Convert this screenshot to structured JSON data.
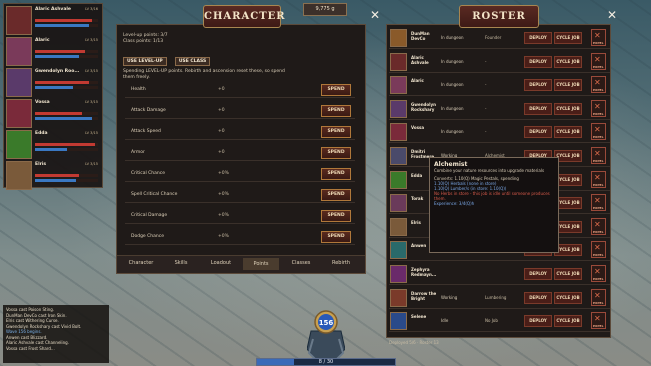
{
  "party": [
    {
      "name": "Alaric Ashvale",
      "level": "LV 3/16",
      "hp": 0.9,
      "mp": 0.85,
      "color": "#6a2a2a"
    },
    {
      "name": "Alaric",
      "level": "LV 3/15",
      "hp": 0.8,
      "mp": 0.7,
      "color": "#7a3a5a"
    },
    {
      "name": "Gwendolyn Roo...",
      "level": "LV 3/15",
      "hp": 0.85,
      "mp": 0.6,
      "color": "#5a3a6a"
    },
    {
      "name": "Vossa",
      "level": "LV 3/15",
      "hp": 0.75,
      "mp": 0.9,
      "color": "#7a2a3a"
    },
    {
      "name": "Edda",
      "level": "LV 3/15",
      "hp": 0.95,
      "mp": 0.5,
      "color": "#3a7a2a"
    },
    {
      "name": "Elris",
      "level": "LV 3/15",
      "hp": 0.7,
      "mp": 0.65,
      "color": "#7a5a3a"
    }
  ],
  "character": {
    "title": "CHARACTER",
    "level_up_points": "Level-up points: 3/7",
    "class_points": "Class points: 1/13",
    "btn_level_up": "USE LEVEL-UP",
    "btn_class": "USE CLASS",
    "desc": "Spending LEVEL-UP points. Rebirth and ascension reset these, so spend them freely.",
    "stats": [
      {
        "label": "Health",
        "value": "+0"
      },
      {
        "label": "Attack Damage",
        "value": "+0"
      },
      {
        "label": "Attack Speed",
        "value": "+0"
      },
      {
        "label": "Armor",
        "value": "+0"
      },
      {
        "label": "Critical Chance",
        "value": "+0%"
      },
      {
        "label": "Spell Critical Chance",
        "value": "+0%"
      },
      {
        "label": "Critical Damage",
        "value": "+0%"
      },
      {
        "label": "Dodge Chance",
        "value": "+0%"
      }
    ],
    "spend_label": "SPEND",
    "tabs": [
      "Character",
      "Skills",
      "Loadout",
      "Points",
      "Classes",
      "Rebirth"
    ],
    "active_tab": "Points"
  },
  "gold": "9,775 g",
  "roster": {
    "title": "ROSTER",
    "deploy_label": "DEPLOY",
    "cycle_label": "CYCLE JOB",
    "expel_label": "EXPEL",
    "rows": [
      {
        "name": "DunMan DevCo",
        "status": "In dungeon",
        "job": "Founder",
        "color": "#8a5a2a"
      },
      {
        "name": "Alaric Ashvale",
        "status": "In dungeon",
        "job": "-",
        "color": "#6a2a2a"
      },
      {
        "name": "Alaric",
        "status": "In dungeon",
        "job": "-",
        "color": "#7a3a5a"
      },
      {
        "name": "Gwendolyn Rockshary",
        "status": "In dungeon",
        "job": "-",
        "color": "#5a3a6a"
      },
      {
        "name": "Vossa",
        "status": "In dungeon",
        "job": "-",
        "color": "#7a2a3a"
      },
      {
        "name": "Dmitri Frostmere",
        "status": "Working",
        "job": "Alchemist",
        "color": "#4a4a6a"
      },
      {
        "name": "Edda",
        "status": "",
        "job": "",
        "color": "#3a7a2a"
      },
      {
        "name": "Torak",
        "status": "",
        "job": "",
        "color": "#6a3a5a"
      },
      {
        "name": "Elris",
        "status": "",
        "job": "",
        "color": "#7a5a3a"
      },
      {
        "name": "Anwen",
        "status": "",
        "job": "",
        "color": "#2a6a6a"
      },
      {
        "name": "Zephyra Redmayn...",
        "status": "",
        "job": "",
        "color": "#6a2a6a"
      },
      {
        "name": "Darrow the Bright",
        "status": "Working",
        "job": "Lumbering",
        "color": "#7a3a2a"
      },
      {
        "name": "Selene",
        "status": "Idle",
        "job": "No Job",
        "color": "#2a4a8a"
      }
    ],
    "footer": "Deployed 5/6 · Roster 13"
  },
  "tooltip": {
    "title": "Alchemist",
    "line1": "Combine your nature resources into upgrade materials",
    "line2": "Converts: 1.10(Q) Magic Pestals, spending",
    "line3": "1.10(Q) Herbals (none in store)",
    "line4": "1.10(Q) Lumber/s (in store: 1.10(Q))",
    "line5": "No Herbs in store - this job is idle until someone produces",
    "line6": "them.",
    "line7": "Experience: 3/4(Q)h"
  },
  "log": [
    "Vossa cast Poison Sting.",
    "DunMan DevCo cast Iron Skin.",
    "Elris cast Withering Curse.",
    "Gwendolyn Rockshary cast Vivid Bolt.",
    "Wave 156 begins.",
    "Anwen cast Blizzard.",
    "Alaric Ashvale cast Channeling.",
    "Vossa cast Frost Shard..."
  ],
  "wave": "156",
  "xp_bar": "8 / 30",
  "xp_fraction": 0.27
}
